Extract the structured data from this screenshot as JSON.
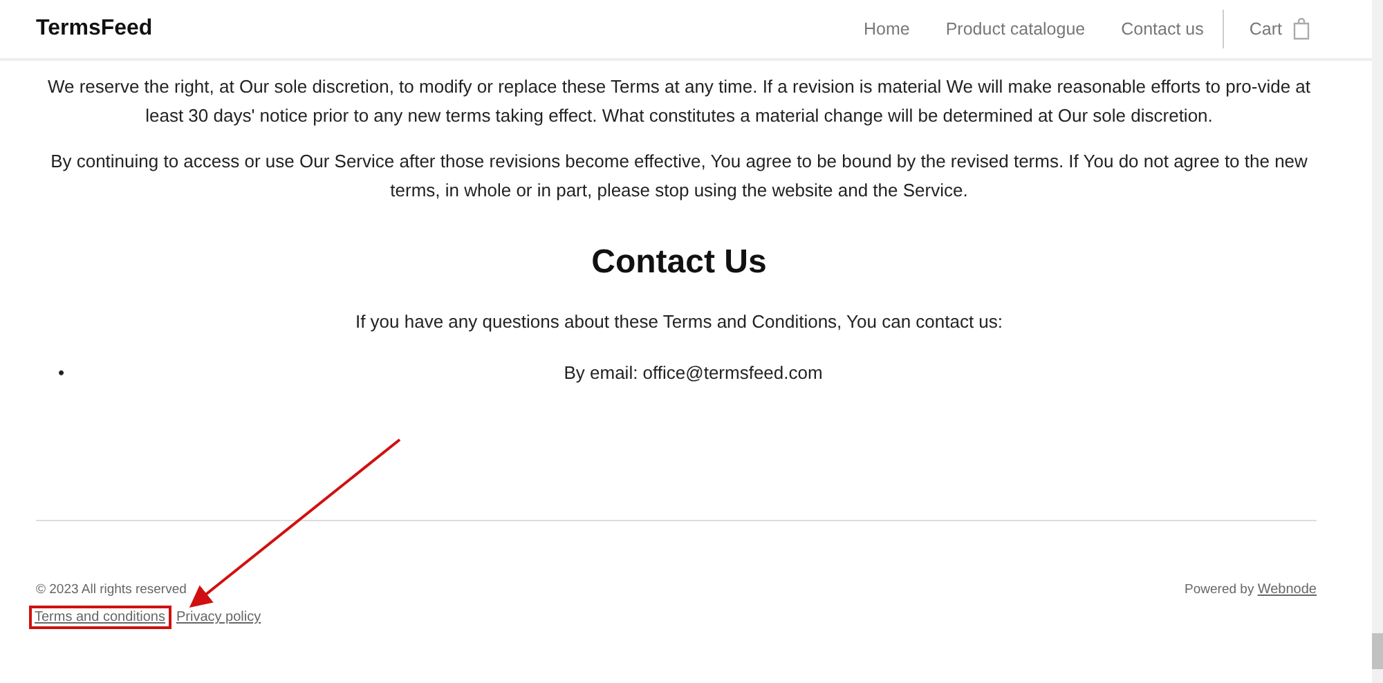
{
  "header": {
    "logo": "TermsFeed",
    "nav": [
      {
        "label": "Home"
      },
      {
        "label": "Product catalogue"
      },
      {
        "label": "Contact us"
      }
    ],
    "cart": "Cart"
  },
  "content": {
    "paragraphs": [
      "We reserve the right, at Our sole discretion, to modify or replace these Terms at any time. If a revision is material We will make reasonable efforts to pro-vide at least 30 days' notice prior to any new terms taking effect. What constitutes a material change will be determined at Our sole discretion.",
      "By continuing to access or use Our Service after those revisions become effective, You agree to be bound by the revised terms. If You do not agree to the new terms, in whole or in part, please stop using the website and the Service."
    ],
    "heading": "Contact Us",
    "intro": "If you have any questions about these Terms and Conditions, You can contact us:",
    "bullets": [
      {
        "marker": "•",
        "text": "By email: office@termsfeed.com"
      }
    ]
  },
  "footer": {
    "copyright": "© 2023 All rights reserved",
    "links": [
      {
        "label": "Terms and conditions",
        "highlighted": true
      },
      {
        "label": "Privacy policy",
        "highlighted": false
      }
    ],
    "powered_by": "Powered by",
    "powered_link": "Webnode"
  }
}
